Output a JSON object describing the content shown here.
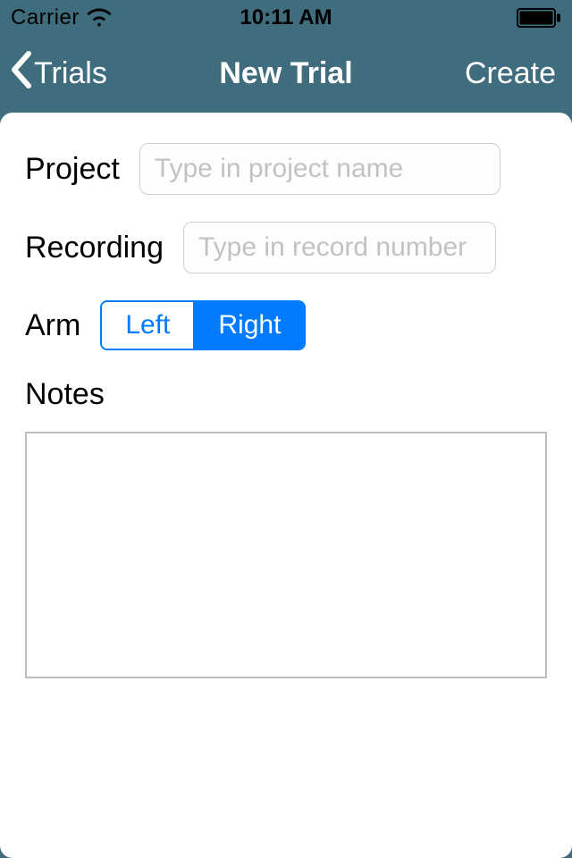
{
  "status": {
    "carrier": "Carrier",
    "time": "10:11 AM"
  },
  "nav": {
    "back_label": "Trials",
    "title": "New Trial",
    "action_label": "Create"
  },
  "form": {
    "project": {
      "label": "Project",
      "placeholder": "Type in project name",
      "value": ""
    },
    "recording": {
      "label": "Recording",
      "placeholder": "Type in record number",
      "value": ""
    },
    "arm": {
      "label": "Arm",
      "options": [
        "Left",
        "Right"
      ],
      "selected": "Right"
    },
    "notes": {
      "label": "Notes",
      "value": ""
    }
  }
}
